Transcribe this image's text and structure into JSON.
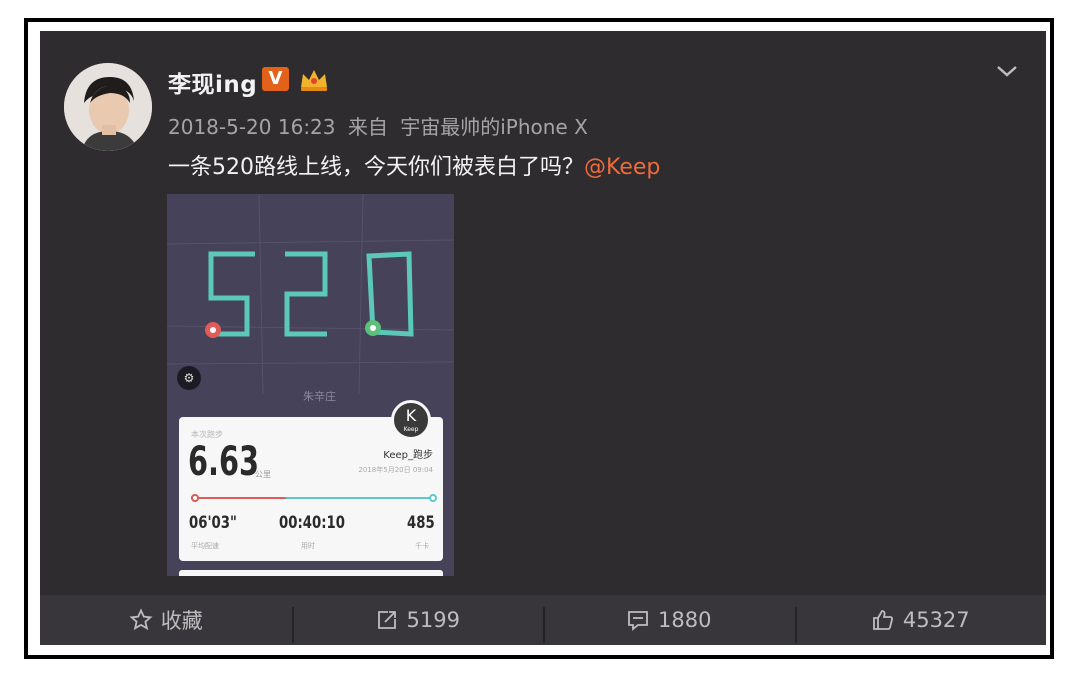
{
  "post": {
    "username": "李现ing",
    "verified_badge": "V",
    "timestamp": "2018-5-20 16:23",
    "source_prefix": "来自",
    "source_device": "宇宙最帅的iPhone X",
    "text": "一条520路线上线，今天你们被表白了吗？",
    "mention": "@Keep"
  },
  "image": {
    "route_shape": "520",
    "area_label": "朱辛庄",
    "card": {
      "header_small": "本次跑步",
      "distance": "6.63",
      "distance_unit": "公里",
      "brand": "Keep_跑步",
      "date": "2018年5月20日 09:04",
      "logo_letter": "K",
      "logo_text": "Keep",
      "progress_fraction": 0.39,
      "pace": "06'03\"",
      "pace_label": "平均配速",
      "duration": "00:40:10",
      "duration_label": "用时",
      "calories": "485",
      "calories_label": "千卡"
    }
  },
  "actions": {
    "favorite_label": "收藏",
    "repost_count": "5199",
    "comment_count": "1880",
    "like_count": "45327"
  },
  "colors": {
    "background": "#2e2c2f",
    "mention": "#ee6b3a",
    "badge": "#e3621b",
    "route": "#5cc9b8"
  },
  "icons": {
    "collapse": "chevron-down-icon",
    "favorite": "star-icon",
    "repost": "repost-icon",
    "comment": "comment-icon",
    "like": "thumbs-up-icon"
  }
}
